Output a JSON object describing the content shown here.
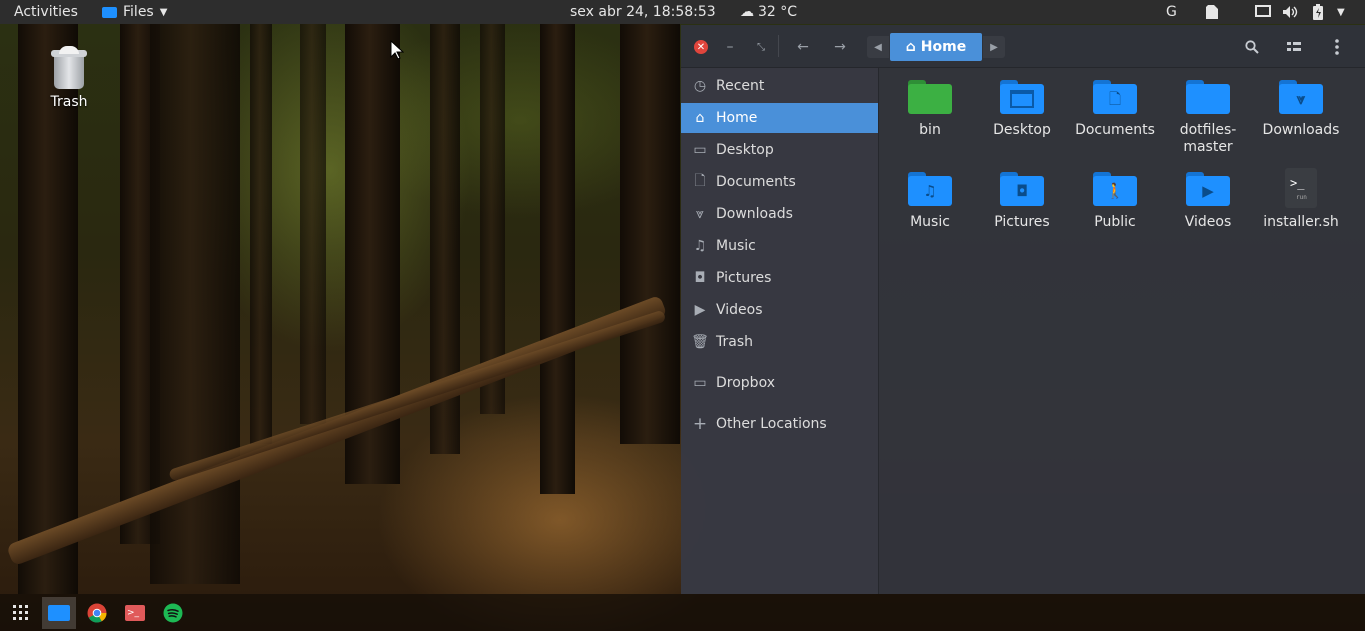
{
  "topbar": {
    "activities": "Activities",
    "app_menu": "Files",
    "clock": "sex abr 24, 18:58:53",
    "weather": "32 °C",
    "keyboard": "G"
  },
  "desktop": {
    "trash_label": "Trash"
  },
  "files": {
    "path_button": "Home",
    "sidebar": [
      {
        "label": "Recent",
        "icon": "clock-icon"
      },
      {
        "label": "Home",
        "icon": "home-icon",
        "active": true
      },
      {
        "label": "Desktop",
        "icon": "desktop-icon"
      },
      {
        "label": "Documents",
        "icon": "document-icon"
      },
      {
        "label": "Downloads",
        "icon": "download-icon"
      },
      {
        "label": "Music",
        "icon": "music-icon"
      },
      {
        "label": "Pictures",
        "icon": "camera-icon"
      },
      {
        "label": "Videos",
        "icon": "video-icon"
      },
      {
        "label": "Trash",
        "icon": "trash-icon"
      },
      {
        "label": "Dropbox",
        "icon": "drive-icon"
      },
      {
        "label": "Other Locations",
        "icon": "plus-icon"
      }
    ],
    "items": [
      {
        "name": "bin",
        "color": "#3cb043"
      },
      {
        "name": "Desktop",
        "color": "#1e90ff"
      },
      {
        "name": "Documents",
        "color": "#1e90ff"
      },
      {
        "name": "dotfiles-master",
        "color": "#1e90ff"
      },
      {
        "name": "Downloads",
        "color": "#1e90ff"
      },
      {
        "name": "Music",
        "color": "#1e90ff"
      },
      {
        "name": "Pictures",
        "color": "#1e90ff"
      },
      {
        "name": "Public",
        "color": "#1e90ff"
      },
      {
        "name": "Videos",
        "color": "#1e90ff"
      },
      {
        "name": "installer.sh",
        "color": "#3a3d42"
      }
    ]
  },
  "colors": {
    "accent": "#4a90d9",
    "folder_blue": "#1e90ff",
    "folder_green": "#3cb043"
  }
}
